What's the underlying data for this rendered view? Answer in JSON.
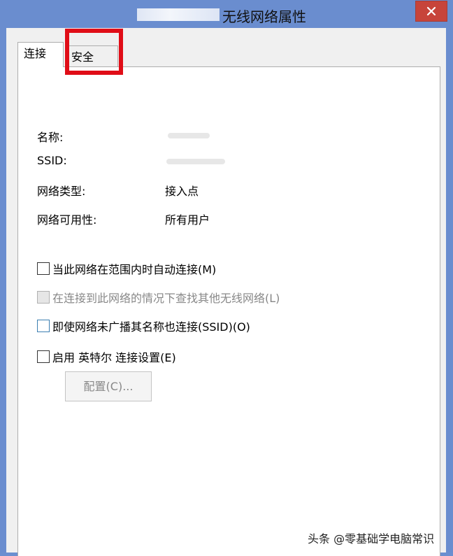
{
  "window": {
    "title_suffix": "无线网络属性",
    "close_icon": "close-icon"
  },
  "tabs": {
    "connection": "连接",
    "security": "安全"
  },
  "info": {
    "name_label": "名称:",
    "ssid_label": "SSID:",
    "network_type_label": "网络类型:",
    "network_type_value": "接入点",
    "availability_label": "网络可用性:",
    "availability_value": "所有用户"
  },
  "options": {
    "auto_connect": "当此网络在范围内时自动连接(M)",
    "look_for_other": "在连接到此网络的情况下查找其他无线网络(L)",
    "connect_hidden": "即使网络未广播其名称也连接(SSID)(O)",
    "intel_settings": "启用 英特尔 连接设置(E)"
  },
  "buttons": {
    "configure": "配置(C)..."
  },
  "watermark": "头条 @零基础学电脑常识",
  "colors": {
    "titlebar": "#6a8dcf",
    "close": "#c7443a",
    "highlight": "#e00d17"
  }
}
